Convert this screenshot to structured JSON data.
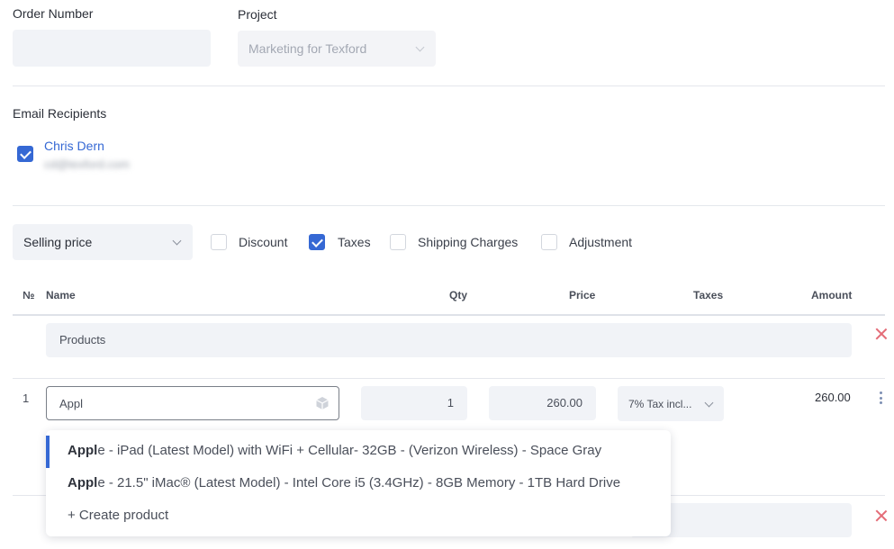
{
  "order": {
    "number_label": "Order Number",
    "number_value": ""
  },
  "project": {
    "label": "Project",
    "value": "Marketing for Texford"
  },
  "email": {
    "label": "Email Recipients",
    "recipient_name": "Chris Dern",
    "recipient_email": "cd@texford.com"
  },
  "pricing": {
    "price_type": "Selling price",
    "options": {
      "discount": "Discount",
      "taxes": "Taxes",
      "shipping": "Shipping Charges",
      "adjustment": "Adjustment"
    }
  },
  "table": {
    "headers": {
      "no": "№",
      "name": "Name",
      "qty": "Qty",
      "price": "Price",
      "taxes": "Taxes",
      "amount": "Amount"
    },
    "section_label": "Products",
    "row": {
      "index": "1",
      "name_value": "Appl",
      "qty": "1",
      "price": "260.00",
      "tax": "7% Tax incl...",
      "amount": "260.00"
    }
  },
  "dropdown": {
    "items": [
      {
        "match": "Appl",
        "rest": "e - iPad (Latest Model) with WiFi + Cellular- 32GB - (Verizon Wireless) - Space Gray"
      },
      {
        "match": "Appl",
        "rest": "e - 21.5\" iMac® (Latest Model) - Intel Core i5 (3.4GHz) - 8GB Memory - 1TB Hard Drive"
      }
    ],
    "create": "+ Create product"
  },
  "colors": {
    "accent": "#3568d4",
    "delete": "#e46d78",
    "field_bg": "#f1f3f7",
    "divider": "#e4e7ec"
  }
}
